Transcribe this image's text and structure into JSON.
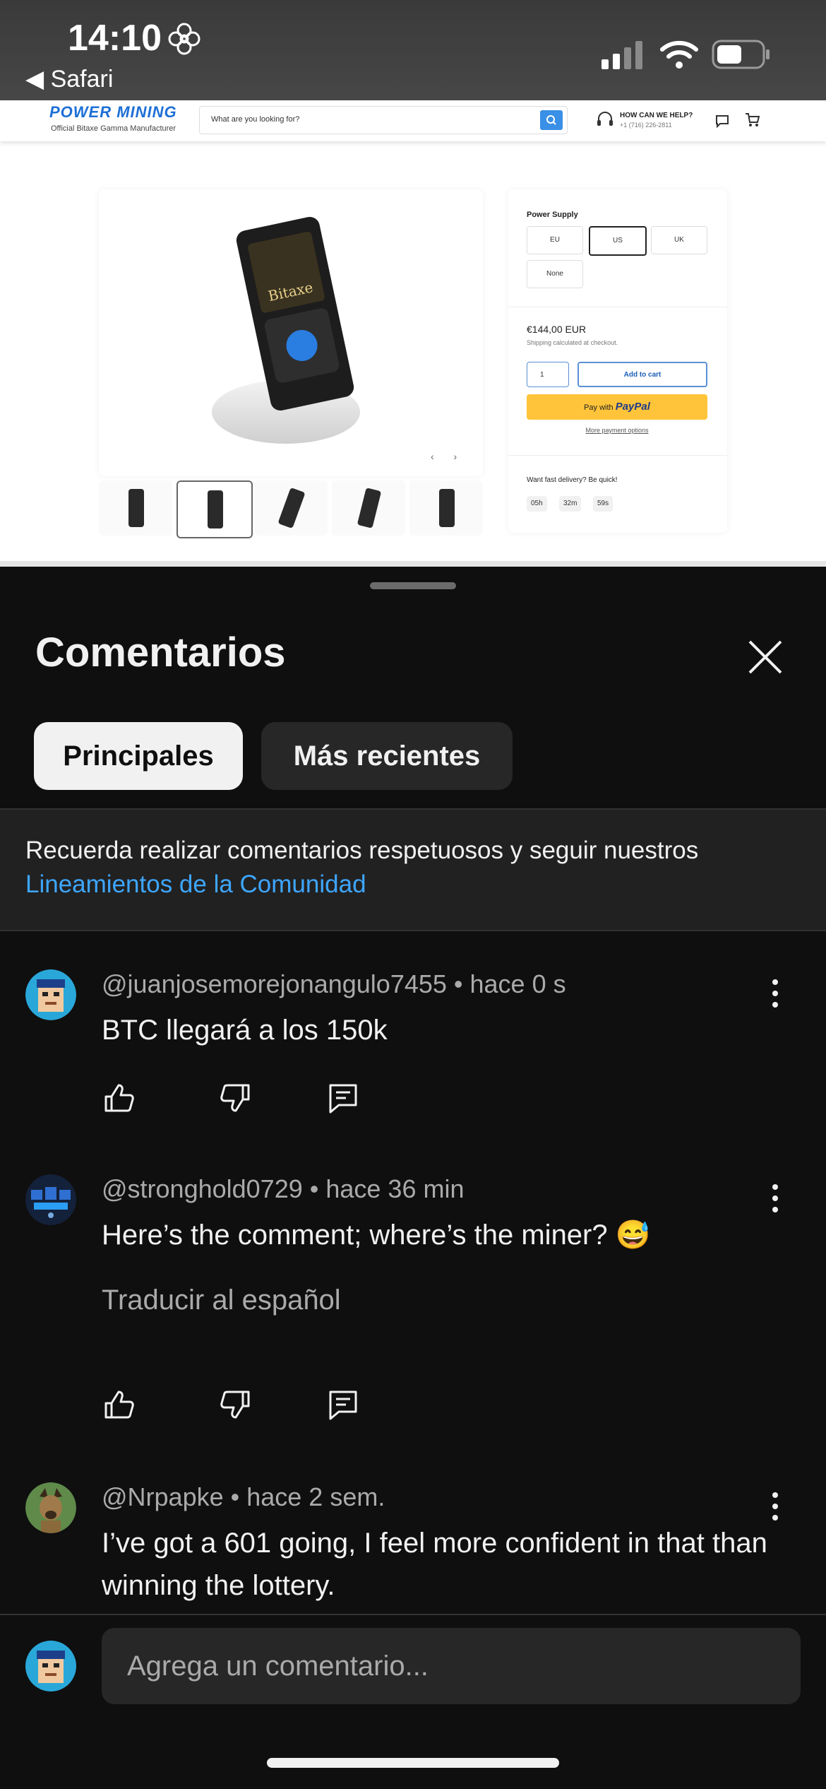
{
  "status_bar": {
    "time": "14:10",
    "back_app": "◀ Safari"
  },
  "website": {
    "brand": "POWER MINING",
    "brand_sub": "Official Bitaxe Gamma Manufacturer",
    "search_placeholder": "What are you looking for?",
    "help_title": "HOW CAN WE HELP?",
    "help_phone": "+1 (716) 226-2811",
    "device_label": "Bitaxe",
    "power_supply_label": "Power Supply",
    "power_options": [
      "EU",
      "US",
      "UK",
      "None"
    ],
    "selected_option": "US",
    "price": "€144,00 EUR",
    "shipping_note": "Shipping calculated at checkout.",
    "quantity": "1",
    "add_to_cart": "Add to cart",
    "paypal_prefix": "Pay with",
    "paypal_brand": "PayPal",
    "more_payment": "More payment options",
    "fast_delivery": "Want fast delivery? Be quick!",
    "timer": [
      "05h",
      "32m",
      "59s"
    ]
  },
  "sheet": {
    "title": "Comentarios",
    "tabs": [
      {
        "label": "Principales",
        "active": true
      },
      {
        "label": "Más recientes",
        "active": false
      }
    ],
    "guidelines_text": "Recuerda realizar comentarios respetuosos y seguir nuestros",
    "guidelines_link": "Lineamientos de la Comunidad"
  },
  "comments": [
    {
      "author": "@juanjosemorejonangulo7455",
      "time": "hace 0 s",
      "text": "BTC llegará a los 150k",
      "avatar": "pixel-avatar-blue"
    },
    {
      "author": "@stronghold0729",
      "time": "hace 36 min",
      "text": "Here’s the comment; where’s the miner? 😅",
      "translate": "Traducir al español",
      "avatar": "tech-avatar"
    },
    {
      "author": "@Nrpapke",
      "time": "hace 2 sem.",
      "text": "I’ve got a 601 going, I feel more confident in that than winning the lottery.",
      "avatar": "dog-avatar"
    }
  ],
  "composer": {
    "placeholder": "Agrega un comentario..."
  },
  "colors": {
    "background": "#0f0f0f",
    "chip_active": "#f1f1f1",
    "chip_inactive": "#272727",
    "link": "#3ea6ff",
    "secondary_text": "#aaaaaa"
  }
}
